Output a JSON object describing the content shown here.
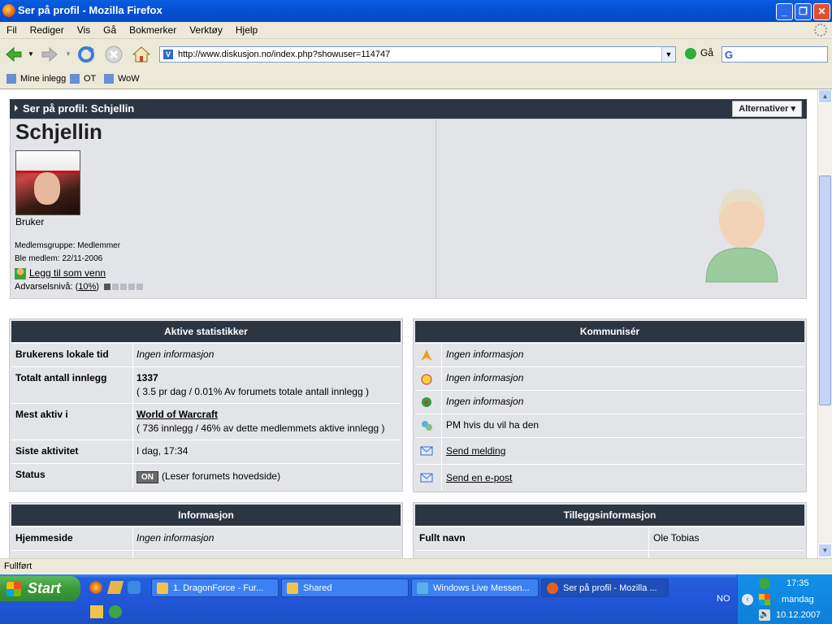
{
  "window": {
    "title": "Ser på profil - Mozilla Firefox"
  },
  "menu": [
    "Fil",
    "Rediger",
    "Vis",
    "Gå",
    "Bokmerker",
    "Verktøy",
    "Hjelp"
  ],
  "navbar": {
    "url": "http://www.diskusjon.no/index.php?showuser=114747",
    "go_label": "Gå",
    "favicon_letter": "V"
  },
  "bookmarks": [
    "Mine inlegg",
    "OT",
    "WoW"
  ],
  "profile": {
    "header": "Ser på profil: Schjellin",
    "options_label": "Alternativer",
    "username": "Schjellin",
    "rank": "Bruker",
    "group": "Medlemsgruppe: Medlemmer",
    "joined": "Ble medlem: 22/11-2006",
    "add_friend": "Legg til som venn",
    "warn_label": "Advarselsnivå: (",
    "warn_value": "10%",
    "warn_close": ")",
    "warn_level": 1
  },
  "stats": {
    "title": "Aktive statistikker",
    "local_time_label": "Brukerens lokale tid",
    "local_time_value": "Ingen informasjon",
    "posts_label": "Totalt antall innlegg",
    "posts_value": "1337",
    "posts_detail": "( 3.5 pr dag / 0.01% Av forumets totale antall innlegg )",
    "active_label": "Mest aktiv i",
    "active_value": "World of Warcraft",
    "active_detail": "( 736 innlegg / 46% av dette medlemmets aktive innlegg )",
    "last_label": "Siste aktivitet",
    "last_value": "I dag, 17:34",
    "status_label": "Status",
    "status_badge": "ON",
    "status_value": "(Leser forumets hovedside)"
  },
  "communicate": {
    "title": "Kommunisér",
    "rows": [
      "Ingen informasjon",
      "Ingen informasjon",
      "Ingen informasjon",
      "PM hvis du vil ha den",
      "Send melding",
      "Send en e-post"
    ]
  },
  "info": {
    "title": "Informasjon",
    "homepage_label": "Hjemmeside",
    "homepage_value": "Ingen informasjon"
  },
  "extra": {
    "title": "Tilleggsinformasjon",
    "fullname_label": "Fullt navn",
    "fullname_value": "Ole Tobias"
  },
  "statusbar": "Fullført",
  "taskbar": {
    "start": "Start",
    "tasks": [
      "1. DragonForce - Fur...",
      "Shared",
      "Windows Live Messen...",
      "Ser på profil - Mozilla ..."
    ],
    "lang": "NO",
    "time": "17:35",
    "day": "mandag",
    "date": "10.12.2007"
  }
}
